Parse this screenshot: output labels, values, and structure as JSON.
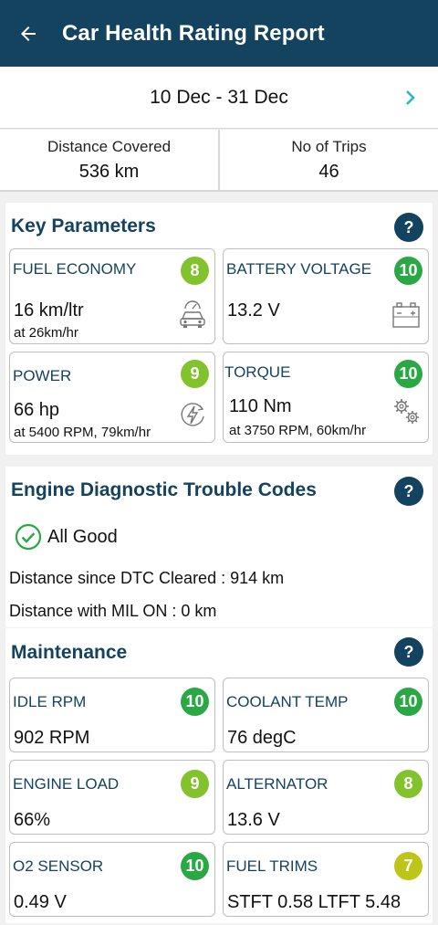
{
  "header": {
    "title": "Car Health Rating Report",
    "back_icon": "arrow-left-icon"
  },
  "date_bar": {
    "range": "10 Dec - 31 Dec",
    "next_icon": "chevron-right-icon"
  },
  "stats": {
    "distance_label": "Distance Covered",
    "distance_value": "536 km",
    "trips_label": "No of Trips",
    "trips_value": "46"
  },
  "key_parameters": {
    "title": "Key Parameters",
    "help": "?",
    "fuel_economy": {
      "name": "FUEL ECONOMY",
      "score": "8",
      "value": "16 km/ltr",
      "sub": "at 26km/hr"
    },
    "battery_voltage": {
      "name": "BATTERY VOLTAGE",
      "score": "10",
      "value": "13.2 V"
    },
    "power": {
      "name": "POWER",
      "score": "9",
      "value": "66 hp",
      "sub": "at 5400 RPM, 79km/hr"
    },
    "torque": {
      "name": "TORQUE",
      "score": "10",
      "value": "110 Nm",
      "sub": "at 3750 RPM, 60km/hr"
    }
  },
  "dtc": {
    "title": "Engine Diagnostic Trouble Codes",
    "help": "?",
    "status": "All Good",
    "since_cleared": "Distance since DTC Cleared : 914 km",
    "mil_on": "Distance with MIL ON : 0 km"
  },
  "maintenance": {
    "title": "Maintenance",
    "help": "?",
    "idle_rpm": {
      "name": "IDLE RPM",
      "score": "10",
      "value": "902 RPM"
    },
    "coolant_temp": {
      "name": "COOLANT TEMP",
      "score": "10",
      "value": "76 degC"
    },
    "engine_load": {
      "name": "ENGINE LOAD",
      "score": "9",
      "value": "66%"
    },
    "alternator": {
      "name": "ALTERNATOR",
      "score": "8",
      "value": "13.6 V"
    },
    "o2_sensor": {
      "name": "O2 SENSOR",
      "score": "10",
      "value": "0.49 V"
    },
    "fuel_trims": {
      "name": "FUEL TRIMS",
      "score": "7",
      "value": "STFT 0.58 LTFT 5.48"
    }
  },
  "colors": {
    "header": "#14435f",
    "score_10": "#2aa845",
    "score_9": "#82c22d",
    "score_8": "#82c22d",
    "score_7": "#bdc616",
    "accent": "#2bb5c6"
  }
}
